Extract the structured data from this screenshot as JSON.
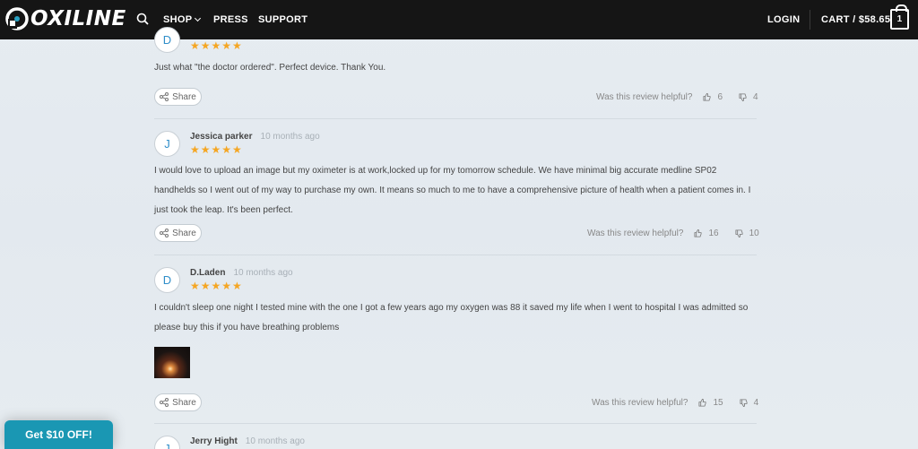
{
  "nav": {
    "brand": "OXILINE",
    "shop": "SHOP",
    "press": "PRESS",
    "support": "SUPPORT",
    "login": "LOGIN",
    "cart": "CART / $58.65",
    "cart_count": "1"
  },
  "reviews": [
    {
      "initial": "D",
      "author": "",
      "ago": "",
      "stars": "★★★★★",
      "text": "Just what \"the doctor ordered\".  Perfect device.  Thank You.",
      "share": "Share",
      "helpful_label": "Was this review helpful?",
      "up": "6",
      "down": "4"
    },
    {
      "initial": "J",
      "author": "Jessica parker",
      "ago": "10 months ago",
      "stars": "★★★★★",
      "text": "I would love to upload an image but my oximeter is at work,locked up for my tomorrow schedule. We have minimal big accurate medline SP02 handhelds  so I went out of my way to purchase my own. It means so much to me to have a comprehensive picture of health when a patient comes in. I just took the leap. It's been perfect.",
      "share": "Share",
      "helpful_label": "Was this review helpful?",
      "up": "16",
      "down": "10"
    },
    {
      "initial": "D",
      "author": "D.Laden",
      "ago": "10 months ago",
      "stars": "★★★★★",
      "text": "I couldn't sleep one night I tested mine with the one I got a few years ago my oxygen was 88 it saved my life when I went to hospital I was admitted so please buy this if you have breathing problems",
      "share": "Share",
      "helpful_label": "Was this review helpful?",
      "up": "15",
      "down": "4"
    },
    {
      "initial": "J",
      "author": "Jerry Hight",
      "ago": "10 months ago"
    }
  ],
  "coupon": "Get $10 OFF!",
  "colors": {
    "accent": "#1a97b3",
    "stars": "#f5a623",
    "nav_bg": "#151515",
    "avatar_text": "#2f8ec9"
  },
  "icons": [
    "search-icon",
    "chevron-down-icon",
    "cart-icon",
    "share-icon",
    "thumbs-up-icon",
    "thumbs-down-icon",
    "star-icon"
  ]
}
